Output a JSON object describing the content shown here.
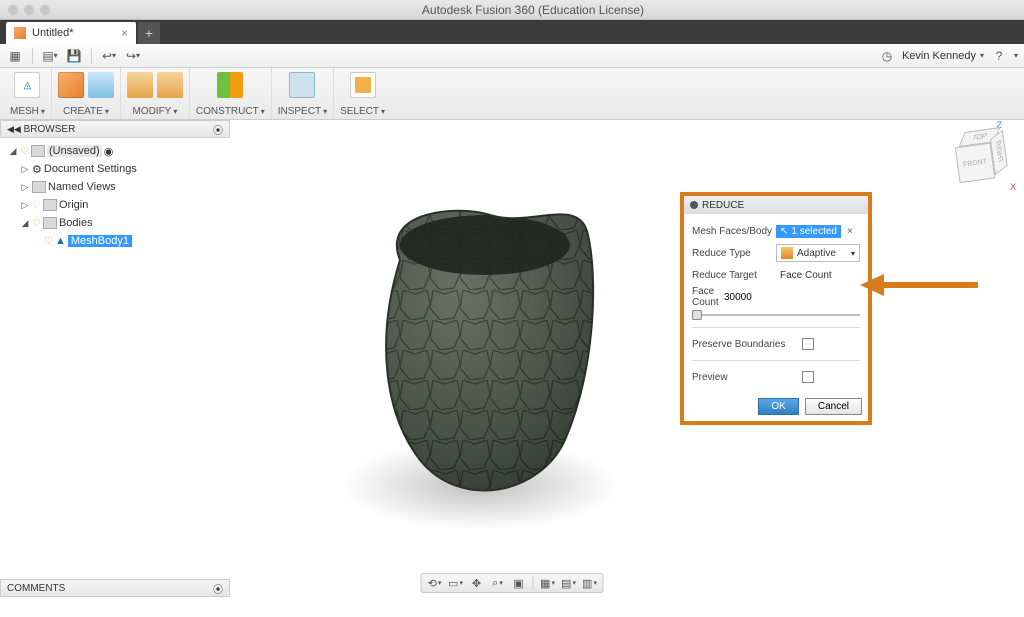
{
  "app_title": "Autodesk Fusion 360 (Education License)",
  "tab_title": "Untitled*",
  "user_name": "Kevin Kennedy",
  "ribbon": {
    "workspace": "MESH",
    "create": "CREATE",
    "modify": "MODIFY",
    "construct": "CONSTRUCT",
    "inspect": "INSPECT",
    "select": "SELECT"
  },
  "browser": {
    "title": "BROWSER",
    "root": "(Unsaved)",
    "doc_settings": "Document Settings",
    "named_views": "Named Views",
    "origin": "Origin",
    "bodies": "Bodies",
    "meshbody": "MeshBody1"
  },
  "viewcube": {
    "front": "FRONT",
    "top": "TOP",
    "right": "RIGHT"
  },
  "dlg": {
    "title": "REDUCE",
    "mesh_faces": "Mesh Faces/Body",
    "selected": "1 selected",
    "reduce_type_l": "Reduce Type",
    "reduce_type_v": "Adaptive",
    "reduce_target_l": "Reduce Target",
    "reduce_target_v": "Face Count",
    "face_count_l": "Face Count",
    "face_count_v": "30000",
    "preserve": "Preserve Boundaries",
    "preview": "Preview",
    "ok": "OK",
    "cancel": "Cancel"
  },
  "comments": "COMMENTS"
}
